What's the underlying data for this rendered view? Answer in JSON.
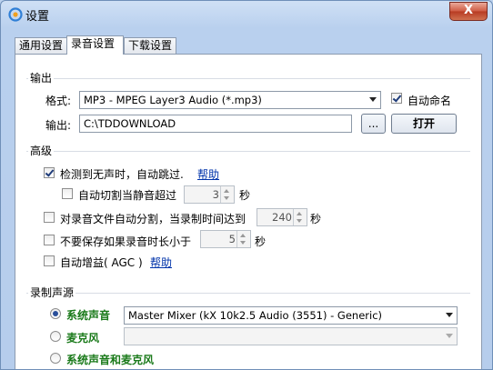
{
  "window": {
    "title": "设置",
    "close_label": "X"
  },
  "tabs": [
    {
      "label": "通用设置"
    },
    {
      "label": "录音设置"
    },
    {
      "label": "下载设置"
    }
  ],
  "output": {
    "group_title": "输出",
    "format_label": "格式:",
    "format_value": "MP3 - MPEG Layer3 Audio (*.mp3)",
    "auto_name_label": "自动命名",
    "output_label": "输出:",
    "output_path": "C:\\TDDOWNLOAD",
    "browse_label": "...",
    "open_label": "打开"
  },
  "advanced": {
    "group_title": "高级",
    "silence_skip_label": "检测到无声时，自动跳过.",
    "help_label": "帮助",
    "auto_cut_label": "自动切割当静音超过",
    "auto_cut_value": "3",
    "seconds": "秒",
    "auto_split_label": "对录音文件自动分割，当录制时间达到",
    "auto_split_value": "240",
    "min_length_label": "不要保存如果录音时长小于",
    "min_length_value": "5",
    "agc_label": "自动增益( AGC )",
    "agc_help_label": "帮助"
  },
  "source": {
    "group_title": "录制声源",
    "system_label": "系统声音",
    "system_device": "Master Mixer (kX 10k2.5 Audio (3551) - Generic)",
    "mic_label": "麦克风",
    "mic_device": "",
    "both_label": "系统声音和麦克风"
  }
}
